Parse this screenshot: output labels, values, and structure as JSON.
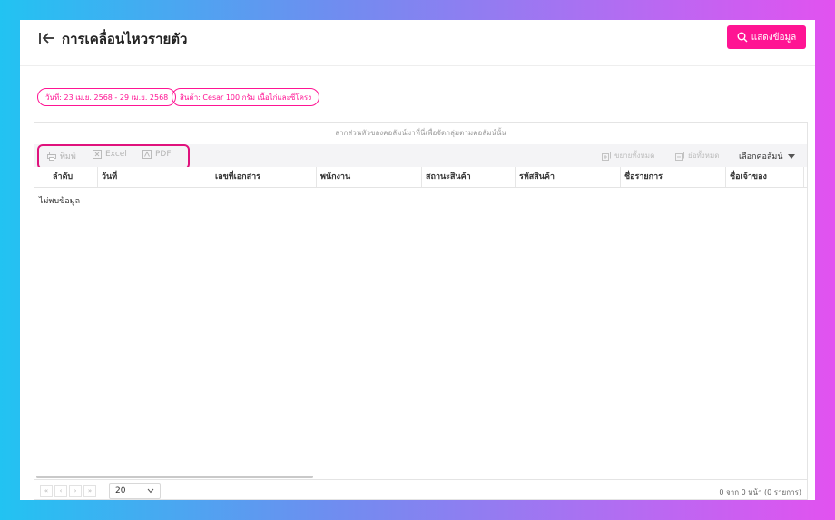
{
  "header": {
    "title": "การเคลื่อนไหวรายตัว",
    "show_button_label": "แสดงข้อมูล"
  },
  "filters": [
    {
      "label": "วันที่: 23 เม.ย. 2568 - 29 เม.ย. 2568"
    },
    {
      "label": "สินค้า: Cesar 100 กรัม เนื้อไก่และซี่โครง"
    }
  ],
  "grid": {
    "group_hint": "ลากส่วนหัวของคอลัมน์มาที่นี่เพื่อจัดกลุ่มตามคอลัมน์นั้น",
    "toolbar": {
      "print_label": "พิมพ์",
      "excel_label": "Excel",
      "pdf_label": "PDF",
      "expand_all_label": "ขยายทั้งหมด",
      "collapse_all_label": "ย่อทั้งหมด",
      "column_chooser_label": "เลือกคอลัมน์"
    },
    "columns": [
      "ลำดับ",
      "วันที่",
      "เลขที่เอกสาร",
      "พนักงาน",
      "สถานะสินค้า",
      "รหัสสินค้า",
      "ชื่อรายการ",
      "ชื่อเจ้าของ"
    ],
    "empty_text": "ไม่พบข้อมูล",
    "pager": {
      "page_size": "20",
      "info": "0 จาก 0 หน้า (0 รายการ)"
    }
  },
  "colors": {
    "accent": "#ff1493",
    "highlight_border": "#e0127d"
  }
}
